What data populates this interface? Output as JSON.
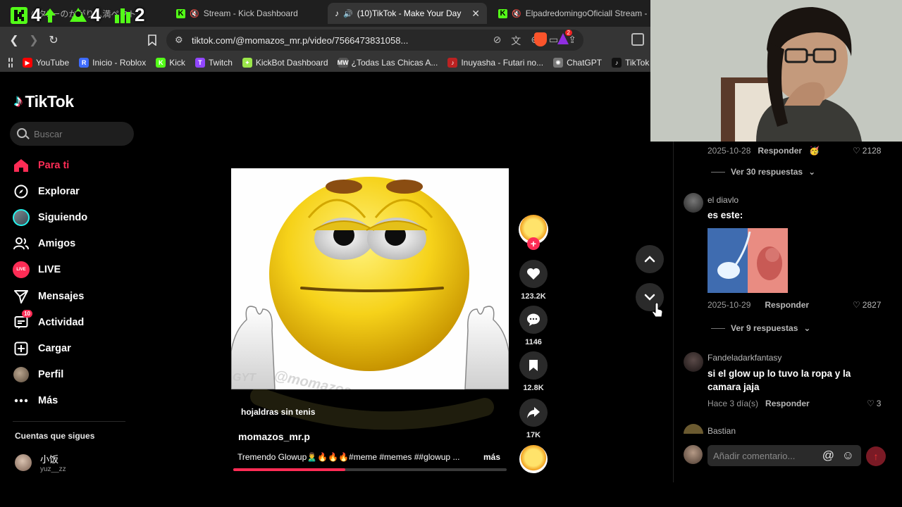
{
  "overlay": {
    "counters": [
      {
        "icon": "kick-icon",
        "value": "4",
        "color": "#53fc18"
      },
      {
        "icon": "follower-icon",
        "value": "4",
        "color": "#53fc18"
      },
      {
        "icon": "bars-icon",
        "value": "2",
        "color": "#53fc18"
      }
    ]
  },
  "tabs": [
    {
      "title": "(Jタ!)ーのかがり灬満ペクト"
    },
    {
      "title": "Stream - Kick Dashboard"
    },
    {
      "title": "(10)TikTok - Make Your Day",
      "active": true
    },
    {
      "title": "ElpadredomingoOficiall Stream -"
    }
  ],
  "address_bar": {
    "url": "tiktok.com/@momazos_mr.p/video/7566473831058..."
  },
  "bookmarks": [
    {
      "label": "YouTube",
      "color": "#ff0000",
      "glyph": "▶"
    },
    {
      "label": "Inicio - Roblox",
      "color": "#3d6bff",
      "glyph": "R"
    },
    {
      "label": "Kick",
      "color": "#53fc18",
      "glyph": "K"
    },
    {
      "label": "Twitch",
      "color": "#9146ff",
      "glyph": "T"
    },
    {
      "label": "KickBot Dashboard",
      "color": "#9be64a",
      "glyph": "✦"
    },
    {
      "label": "¿Todas Las Chicas A...",
      "color": "#555",
      "glyph": "MW"
    },
    {
      "label": "Inuyasha - Futari no...",
      "color": "#b22",
      "glyph": "♪"
    },
    {
      "label": "ChatGPT",
      "color": "#777",
      "glyph": "✺"
    },
    {
      "label": "TikTok -",
      "color": "#111",
      "glyph": "♪"
    }
  ],
  "tiktok": {
    "logo": "TikTok",
    "search_placeholder": "Buscar",
    "menu": [
      {
        "label": "Para ti",
        "icon": "home-icon"
      },
      {
        "label": "Explorar",
        "icon": "compass-icon"
      },
      {
        "label": "Siguiendo",
        "icon": "following-avatar-icon"
      },
      {
        "label": "Amigos",
        "icon": "friends-icon"
      },
      {
        "label": "LIVE",
        "icon": "live-icon"
      },
      {
        "label": "Mensajes",
        "icon": "send-icon"
      },
      {
        "label": "Actividad",
        "icon": "activity-icon",
        "badge": "10"
      },
      {
        "label": "Cargar",
        "icon": "upload-icon"
      },
      {
        "label": "Perfil",
        "icon": "profile-avatar-icon"
      },
      {
        "label": "Más",
        "icon": "more-icon"
      }
    ],
    "following_title": "Cuentas que sigues",
    "following": [
      {
        "name": "小饭",
        "handle": "yuz__zz"
      }
    ]
  },
  "video": {
    "watermark_tag": "GYT",
    "sound_name": "hojaldras sin tenis",
    "author": "momazos_mr.p",
    "caption": "Tremendo Glowup🙎‍♂️🔥🔥🔥#meme #memes ##glowup ...",
    "more_label": "más",
    "progress": 0.41,
    "actions": {
      "likes": "123.2K",
      "comments": "1146",
      "saves": "12.8K",
      "shares": "17K"
    }
  },
  "comments": {
    "first": {
      "date": "2025-10-28",
      "reply_label": "Responder",
      "likes": "2128",
      "view_replies": "Ver 30 respuestas"
    },
    "second": {
      "user": "el diavlo",
      "text": "es este:",
      "date": "2025-10-29",
      "reply_label": "Responder",
      "likes": "2827",
      "view_replies": "Ver 9 respuestas"
    },
    "third": {
      "user": "Fandeladarkfantasy",
      "text": "si el glow up lo tuvo la ropa y la camara jaja",
      "date": "Hace 3 día(s)",
      "reply_label": "Responder",
      "likes": "3"
    },
    "fourth": {
      "user": "Bastian"
    },
    "input_placeholder": "Añadir comentario..."
  }
}
